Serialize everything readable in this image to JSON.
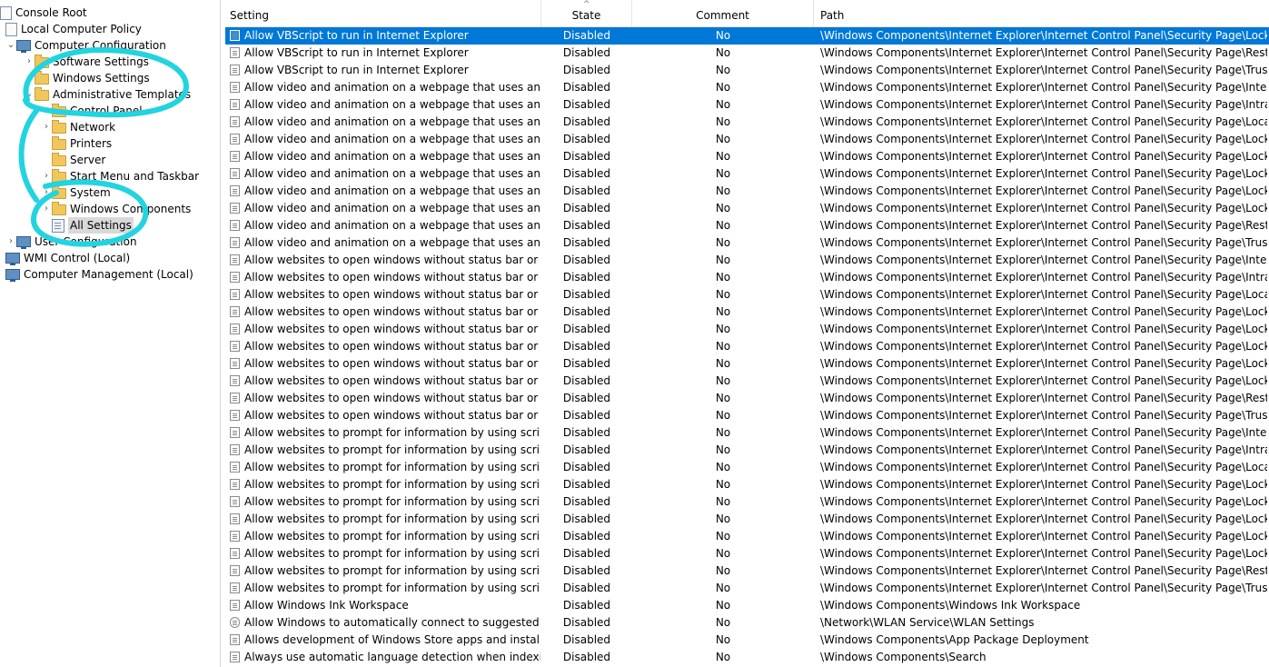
{
  "tree": {
    "console_root": "Console Root",
    "local_policy": "Local Computer Policy",
    "computer_config": "Computer Configuration",
    "software_settings": "Software Settings",
    "windows_settings": "Windows Settings",
    "admin_templates": "Administrative Templates",
    "control_panel": "Control Panel",
    "network": "Network",
    "printers": "Printers",
    "server": "Server",
    "start_menu": "Start Menu and Taskbar",
    "system": "System",
    "windows_components": "Windows Components",
    "all_settings": "All Settings",
    "user_config": "User Configuration",
    "wmi": "WMI Control (Local)",
    "comp_mgmt": "Computer Management (Local)"
  },
  "headers": {
    "setting": "Setting",
    "state": "State",
    "comment": "Comment",
    "path": "Path"
  },
  "annotation_color": "#22d3e0",
  "selected_color": "#0078d7",
  "rows": [
    {
      "setting": "Allow VBScript to run in Internet Explorer",
      "state": "Disabled",
      "comment": "No",
      "path": "\\Windows Components\\Internet Explorer\\Internet Control Panel\\Security Page\\Locked-..."
    },
    {
      "setting": "Allow VBScript to run in Internet Explorer",
      "state": "Disabled",
      "comment": "No",
      "path": "\\Windows Components\\Internet Explorer\\Internet Control Panel\\Security Page\\Restricte..."
    },
    {
      "setting": "Allow VBScript to run in Internet Explorer",
      "state": "Disabled",
      "comment": "No",
      "path": "\\Windows Components\\Internet Explorer\\Internet Control Panel\\Security Page\\Trusted S..."
    },
    {
      "setting": "Allow video and animation on a webpage that uses an older...",
      "state": "Disabled",
      "comment": "No",
      "path": "\\Windows Components\\Internet Explorer\\Internet Control Panel\\Security Page\\Internet ..."
    },
    {
      "setting": "Allow video and animation on a webpage that uses an older...",
      "state": "Disabled",
      "comment": "No",
      "path": "\\Windows Components\\Internet Explorer\\Internet Control Panel\\Security Page\\Intranet ..."
    },
    {
      "setting": "Allow video and animation on a webpage that uses an older...",
      "state": "Disabled",
      "comment": "No",
      "path": "\\Windows Components\\Internet Explorer\\Internet Control Panel\\Security Page\\Local Ma..."
    },
    {
      "setting": "Allow video and animation on a webpage that uses an older...",
      "state": "Disabled",
      "comment": "No",
      "path": "\\Windows Components\\Internet Explorer\\Internet Control Panel\\Security Page\\Locked-..."
    },
    {
      "setting": "Allow video and animation on a webpage that uses an older...",
      "state": "Disabled",
      "comment": "No",
      "path": "\\Windows Components\\Internet Explorer\\Internet Control Panel\\Security Page\\Locked-..."
    },
    {
      "setting": "Allow video and animation on a webpage that uses an older...",
      "state": "Disabled",
      "comment": "No",
      "path": "\\Windows Components\\Internet Explorer\\Internet Control Panel\\Security Page\\Locked-..."
    },
    {
      "setting": "Allow video and animation on a webpage that uses an older...",
      "state": "Disabled",
      "comment": "No",
      "path": "\\Windows Components\\Internet Explorer\\Internet Control Panel\\Security Page\\Locked-..."
    },
    {
      "setting": "Allow video and animation on a webpage that uses an older...",
      "state": "Disabled",
      "comment": "No",
      "path": "\\Windows Components\\Internet Explorer\\Internet Control Panel\\Security Page\\Locked-..."
    },
    {
      "setting": "Allow video and animation on a webpage that uses an older...",
      "state": "Disabled",
      "comment": "No",
      "path": "\\Windows Components\\Internet Explorer\\Internet Control Panel\\Security Page\\Restricte..."
    },
    {
      "setting": "Allow video and animation on a webpage that uses an older...",
      "state": "Disabled",
      "comment": "No",
      "path": "\\Windows Components\\Internet Explorer\\Internet Control Panel\\Security Page\\Trusted S..."
    },
    {
      "setting": "Allow websites to open windows without status bar or Addr...",
      "state": "Disabled",
      "comment": "No",
      "path": "\\Windows Components\\Internet Explorer\\Internet Control Panel\\Security Page\\Internet ..."
    },
    {
      "setting": "Allow websites to open windows without status bar or Addr...",
      "state": "Disabled",
      "comment": "No",
      "path": "\\Windows Components\\Internet Explorer\\Internet Control Panel\\Security Page\\Intranet ..."
    },
    {
      "setting": "Allow websites to open windows without status bar or Addr...",
      "state": "Disabled",
      "comment": "No",
      "path": "\\Windows Components\\Internet Explorer\\Internet Control Panel\\Security Page\\Local Ma..."
    },
    {
      "setting": "Allow websites to open windows without status bar or Addr...",
      "state": "Disabled",
      "comment": "No",
      "path": "\\Windows Components\\Internet Explorer\\Internet Control Panel\\Security Page\\Locked-..."
    },
    {
      "setting": "Allow websites to open windows without status bar or Addr...",
      "state": "Disabled",
      "comment": "No",
      "path": "\\Windows Components\\Internet Explorer\\Internet Control Panel\\Security Page\\Locked-..."
    },
    {
      "setting": "Allow websites to open windows without status bar or Addr...",
      "state": "Disabled",
      "comment": "No",
      "path": "\\Windows Components\\Internet Explorer\\Internet Control Panel\\Security Page\\Locked-..."
    },
    {
      "setting": "Allow websites to open windows without status bar or Addr...",
      "state": "Disabled",
      "comment": "No",
      "path": "\\Windows Components\\Internet Explorer\\Internet Control Panel\\Security Page\\Locked-..."
    },
    {
      "setting": "Allow websites to open windows without status bar or Addr...",
      "state": "Disabled",
      "comment": "No",
      "path": "\\Windows Components\\Internet Explorer\\Internet Control Panel\\Security Page\\Locked-..."
    },
    {
      "setting": "Allow websites to open windows without status bar or Addr...",
      "state": "Disabled",
      "comment": "No",
      "path": "\\Windows Components\\Internet Explorer\\Internet Control Panel\\Security Page\\Restricte..."
    },
    {
      "setting": "Allow websites to open windows without status bar or Addr...",
      "state": "Disabled",
      "comment": "No",
      "path": "\\Windows Components\\Internet Explorer\\Internet Control Panel\\Security Page\\Trusted S..."
    },
    {
      "setting": "Allow websites to prompt for information by using scripted ...",
      "state": "Disabled",
      "comment": "No",
      "path": "\\Windows Components\\Internet Explorer\\Internet Control Panel\\Security Page\\Internet ..."
    },
    {
      "setting": "Allow websites to prompt for information by using scripted ...",
      "state": "Disabled",
      "comment": "No",
      "path": "\\Windows Components\\Internet Explorer\\Internet Control Panel\\Security Page\\Intranet ..."
    },
    {
      "setting": "Allow websites to prompt for information by using scripted ...",
      "state": "Disabled",
      "comment": "No",
      "path": "\\Windows Components\\Internet Explorer\\Internet Control Panel\\Security Page\\Local Ma..."
    },
    {
      "setting": "Allow websites to prompt for information by using scripted ...",
      "state": "Disabled",
      "comment": "No",
      "path": "\\Windows Components\\Internet Explorer\\Internet Control Panel\\Security Page\\Locked-..."
    },
    {
      "setting": "Allow websites to prompt for information by using scripted ...",
      "state": "Disabled",
      "comment": "No",
      "path": "\\Windows Components\\Internet Explorer\\Internet Control Panel\\Security Page\\Locked-..."
    },
    {
      "setting": "Allow websites to prompt for information by using scripted ...",
      "state": "Disabled",
      "comment": "No",
      "path": "\\Windows Components\\Internet Explorer\\Internet Control Panel\\Security Page\\Locked-..."
    },
    {
      "setting": "Allow websites to prompt for information by using scripted ...",
      "state": "Disabled",
      "comment": "No",
      "path": "\\Windows Components\\Internet Explorer\\Internet Control Panel\\Security Page\\Locked-..."
    },
    {
      "setting": "Allow websites to prompt for information by using scripted ...",
      "state": "Disabled",
      "comment": "No",
      "path": "\\Windows Components\\Internet Explorer\\Internet Control Panel\\Security Page\\Locked-..."
    },
    {
      "setting": "Allow websites to prompt for information by using scripted ...",
      "state": "Disabled",
      "comment": "No",
      "path": "\\Windows Components\\Internet Explorer\\Internet Control Panel\\Security Page\\Restricte..."
    },
    {
      "setting": "Allow websites to prompt for information by using scripted ...",
      "state": "Disabled",
      "comment": "No",
      "path": "\\Windows Components\\Internet Explorer\\Internet Control Panel\\Security Page\\Trusted S..."
    },
    {
      "setting": "Allow Windows Ink Workspace",
      "state": "Disabled",
      "comment": "No",
      "path": "\\Windows Components\\Windows Ink Workspace"
    },
    {
      "setting": "Allow Windows to automatically connect to suggested ope...",
      "state": "Disabled",
      "comment": "No",
      "path": "\\Network\\WLAN Service\\WLAN Settings"
    },
    {
      "setting": "Allows development of Windows Store apps and installing t...",
      "state": "Disabled",
      "comment": "No",
      "path": "\\Windows Components\\App Package Deployment"
    },
    {
      "setting": "Always use automatic language detection when indexing co...",
      "state": "Disabled",
      "comment": "No",
      "path": "\\Windows Components\\Search"
    }
  ]
}
